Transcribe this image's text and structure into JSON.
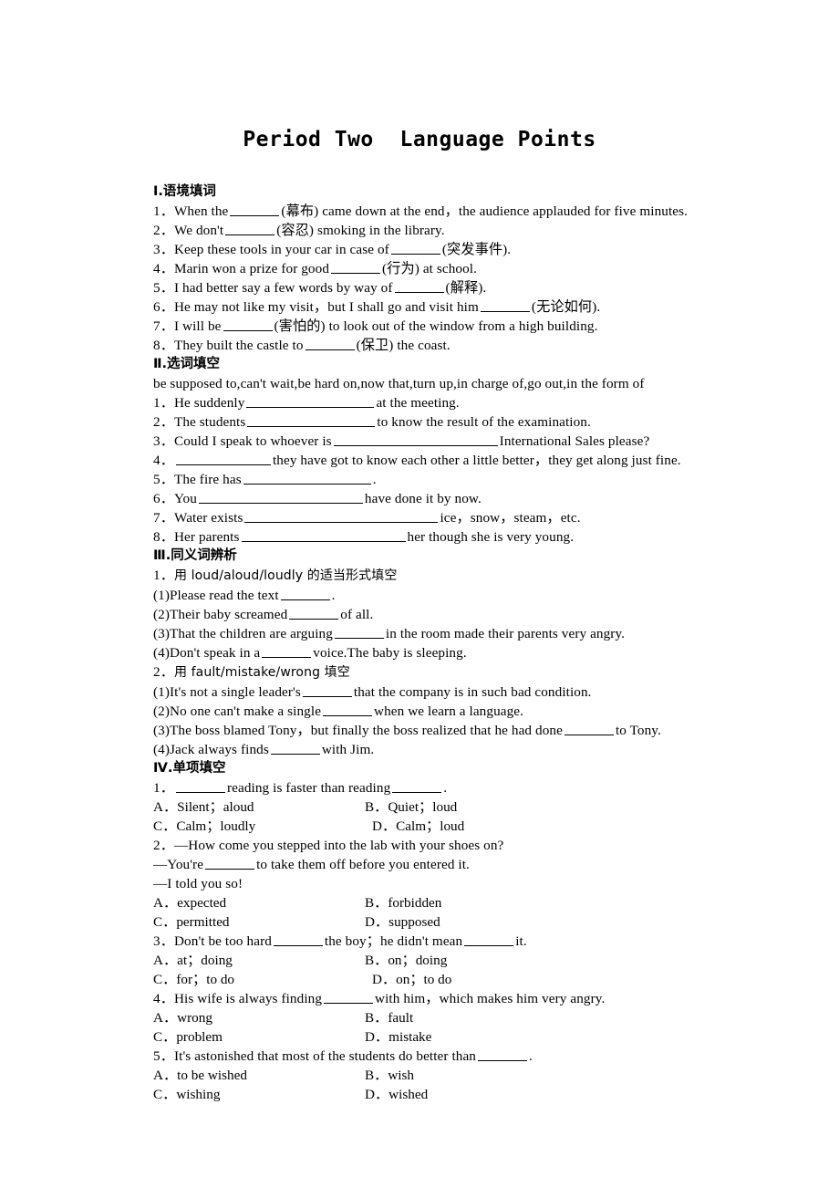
{
  "document": {
    "title": "Period Two  Language Points"
  },
  "sections": [
    {
      "id": "section-1",
      "heading": "Ⅰ.语境填词",
      "items": [
        {
          "num": "1．",
          "pre": "When the",
          "mid": "(幕布) came down at the end，the audience applauded for five minutes.",
          "blank": "b-s"
        },
        {
          "num": "2．",
          "pre": "We don't",
          "mid": "(容忍) smoking in the library.",
          "blank": "b-s"
        },
        {
          "num": "3．",
          "pre": "Keep these tools in your car in case of",
          "mid": "(突发事件).",
          "blank": "b-s"
        },
        {
          "num": "4．",
          "pre": "Marin won a prize for good",
          "mid": "(行为) at school.",
          "blank": "b-s"
        },
        {
          "num": "5．",
          "pre": "I had better say a few words by way of",
          "mid": "(解释).",
          "blank": "b-s"
        },
        {
          "num": "6．",
          "pre": "He may not like my visit，but I shall go and visit him",
          "mid": "(无论如何).",
          "blank": "b-s"
        },
        {
          "num": "7．",
          "pre": "I will be",
          "mid": "(害怕的) to look out of the window from a high building.",
          "blank": "b-s"
        },
        {
          "num": "8．",
          "pre": "They built the castle to",
          "mid": "(保卫) the coast.",
          "blank": "b-s"
        }
      ]
    },
    {
      "id": "section-2",
      "heading": "Ⅱ.选词填空",
      "wordbank": "be supposed to,can't wait,be hard on,now that,turn up,in charge of,go out,in the form of",
      "items": [
        {
          "num": "1．",
          "pre": "He suddenly",
          "mid": "at the meeting.",
          "blank": "b-l"
        },
        {
          "num": "2．",
          "pre": "The students",
          "mid": "to know the result of the examination.",
          "blank": "b-l"
        },
        {
          "num": "3．",
          "pre": "Could I speak to whoever is",
          "mid": "International Sales please?",
          "blank": "b-xl"
        },
        {
          "num": "4．",
          "pre": "",
          "mid": "they have got to know each other a little better，they get along just fine.",
          "blank": "b-m"
        },
        {
          "num": "5．",
          "pre": "The fire has",
          "mid": ".",
          "blank": "b-l"
        },
        {
          "num": "6．",
          "pre": "You",
          "mid": "have done it by now.",
          "blank": "b-xl"
        },
        {
          "num": "7．",
          "pre": "Water exists",
          "mid": "ice，snow，steam，etc.",
          "blank": "b-xxl"
        },
        {
          "num": "8．",
          "pre": "Her parents",
          "mid": "her though she is very young.",
          "blank": "b-xl"
        }
      ]
    },
    {
      "id": "section-3",
      "heading": "Ⅲ.同义词辨析",
      "groups": [
        {
          "prompt_num": "1．",
          "prompt": "用 loud/aloud/loudly 的适当形式填空",
          "items": [
            {
              "num": "(1)",
              "pre": "Please read the text",
              "mid": ".",
              "blank": "b-s"
            },
            {
              "num": "(2)",
              "pre": "Their baby screamed",
              "mid": "of all.",
              "blank": "b-s"
            },
            {
              "num": "(3)",
              "pre": "That the children are arguing",
              "mid": "in the room made their parents very angry.",
              "blank": "b-s"
            },
            {
              "num": "(4)",
              "pre": "Don't speak in a",
              "mid": "voice.The baby is sleeping.",
              "blank": "b-s"
            }
          ]
        },
        {
          "prompt_num": "2．",
          "prompt": "用 fault/mistake/wrong 填空",
          "items": [
            {
              "num": "(1)",
              "pre": "It's not a single leader's",
              "mid": "that the company is in such bad condition.",
              "blank": "b-s"
            },
            {
              "num": "(2)",
              "pre": "No one can't make a single",
              "mid": "when we learn a language.",
              "blank": "b-s"
            },
            {
              "num": "(3)",
              "pre": "The boss blamed Tony，but finally the boss realized that he had done",
              "mid": "to Tony.",
              "blank": "b-s"
            },
            {
              "num": "(4)",
              "pre": "Jack always finds",
              "mid": "with Jim.",
              "blank": "b-s"
            }
          ]
        }
      ]
    },
    {
      "id": "section-4",
      "heading": "Ⅳ.单项填空",
      "questions": [
        {
          "num": "1．",
          "stem_pre": "",
          "stem_post": "reading is faster than reading",
          "stem_tail": ".",
          "two_blanks": true,
          "options": [
            {
              "label": "A．",
              "text": "Silent；aloud"
            },
            {
              "label": "B．",
              "text": "Quiet；loud"
            },
            {
              "label": "C．",
              "text": "Calm；loudly"
            },
            {
              "label": "D．",
              "text": "Calm；loud"
            }
          ]
        },
        {
          "num": "2．",
          "dialogue": [
            "—How come you stepped into the lab with your shoes on?",
            "—I told you so!"
          ],
          "dialogue_blank_line_pre": "—You're",
          "dialogue_blank_line_post": "to take them off before you entered it.",
          "options": [
            {
              "label": "A．",
              "text": "expected"
            },
            {
              "label": "B．",
              "text": "forbidden"
            },
            {
              "label": "C．",
              "text": "permitted"
            },
            {
              "label": "D．",
              "text": "supposed"
            }
          ]
        },
        {
          "num": "3．",
          "stem_pre": "Don't be too hard",
          "stem_post": "the boy；he didn't mean",
          "stem_tail": "it.",
          "two_blanks": true,
          "options": [
            {
              "label": "A．",
              "text": "at；doing"
            },
            {
              "label": "B．",
              "text": "on；doing"
            },
            {
              "label": "C．",
              "text": "for；to do"
            },
            {
              "label": "D．",
              "text": "on；to do"
            }
          ]
        },
        {
          "num": "4．",
          "stem_pre": "His wife is always finding",
          "stem_post": "with him，which makes him very angry.",
          "options": [
            {
              "label": "A．",
              "text": "wrong"
            },
            {
              "label": "B．",
              "text": "fault"
            },
            {
              "label": "C．",
              "text": "problem"
            },
            {
              "label": "D．",
              "text": "mistake"
            }
          ]
        },
        {
          "num": "5．",
          "stem_pre": "It's astonished that most of the students do better than",
          "stem_post": ".",
          "options": [
            {
              "label": "A．",
              "text": "to be wished"
            },
            {
              "label": "B．",
              "text": "wish"
            },
            {
              "label": "C．",
              "text": "wishing"
            },
            {
              "label": "D．",
              "text": "wished"
            }
          ]
        }
      ]
    }
  ]
}
